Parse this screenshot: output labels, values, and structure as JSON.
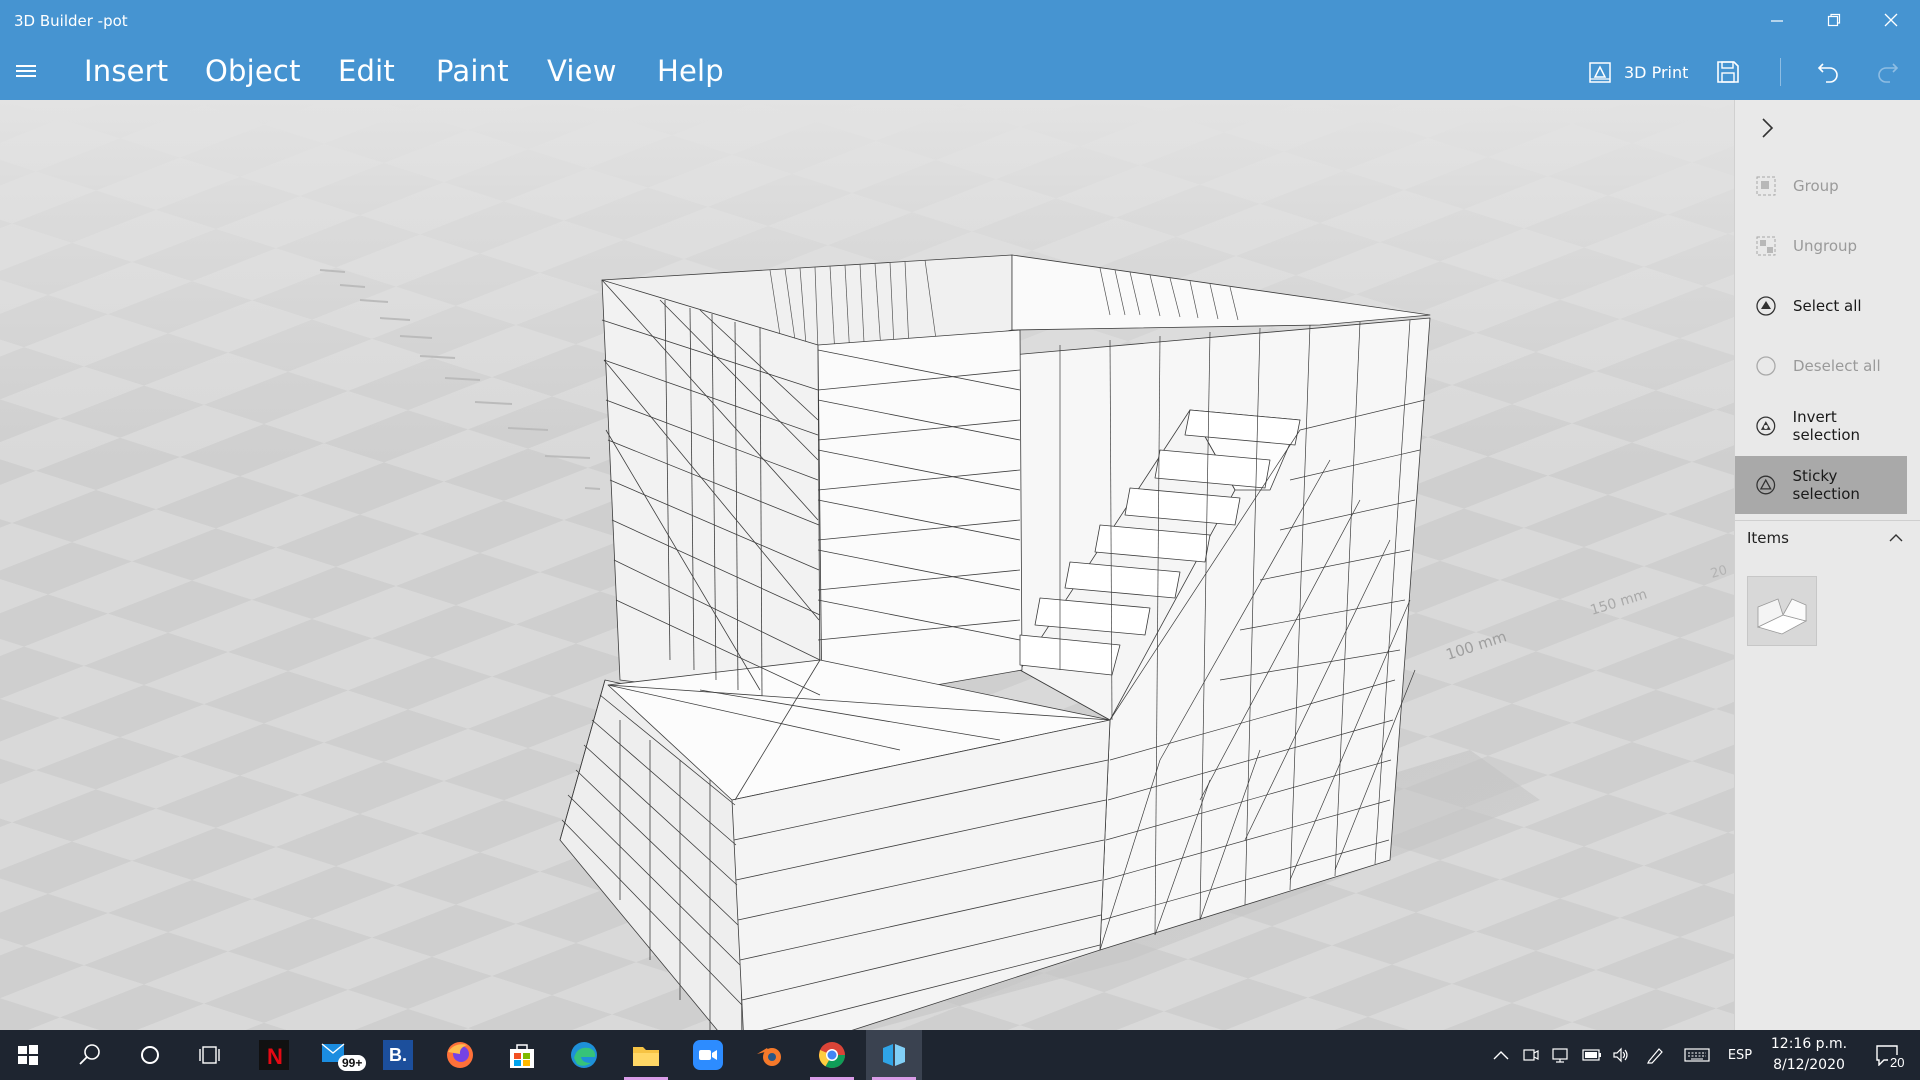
{
  "window": {
    "title": "3D Builder -pot",
    "minimize": "—",
    "restore": "❐",
    "close": "✕"
  },
  "menu": {
    "items": [
      "Insert",
      "Object",
      "Edit",
      "Paint",
      "View",
      "Help"
    ]
  },
  "toolbar": {
    "print_label": "3D Print"
  },
  "viewport": {
    "scale_labels": [
      "100 mm",
      "150 mm",
      "20"
    ]
  },
  "panel": {
    "actions": [
      {
        "label": "Group",
        "icon": "group-icon",
        "enabled": false
      },
      {
        "label": "Ungroup",
        "icon": "ungroup-icon",
        "enabled": false
      },
      {
        "label": "Select all",
        "icon": "select-all-icon",
        "enabled": true
      },
      {
        "label": "Deselect all",
        "icon": "deselect-all-icon",
        "enabled": false
      },
      {
        "label": "Invert selection",
        "icon": "invert-selection-icon",
        "enabled": true
      },
      {
        "label": "Sticky selection",
        "icon": "sticky-selection-icon",
        "enabled": true,
        "active": true
      }
    ],
    "items_label": "Items"
  },
  "taskbar": {
    "mail_badge": "99+",
    "booking_letter": "B.",
    "language": "ESP",
    "time": "12:16 p.m.",
    "date": "8/12/2020",
    "notification_count": "20"
  },
  "colors": {
    "accent": "#4694d1",
    "panel_bg": "#e9e9e9",
    "active_item": "#a9a9a9",
    "taskbar": "#1e2530"
  }
}
